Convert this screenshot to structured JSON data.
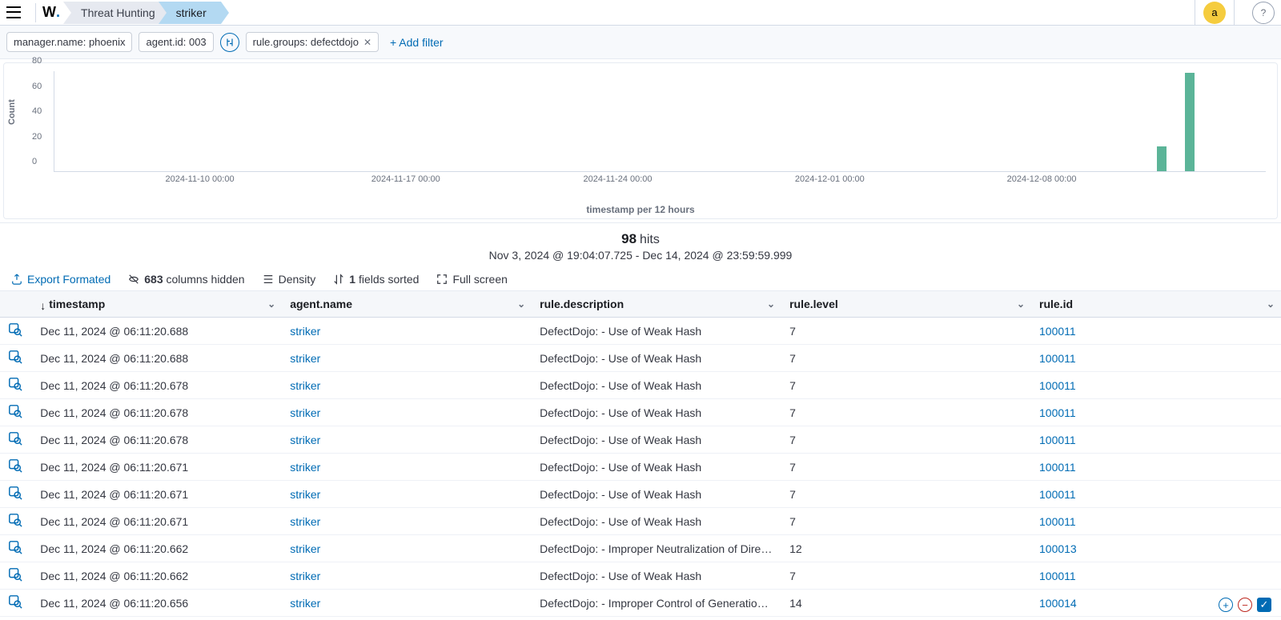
{
  "header": {
    "breadcrumbs": [
      "Threat Hunting",
      "striker"
    ],
    "avatar_letter": "a"
  },
  "filters": {
    "pills": [
      {
        "label": "manager.name: phoenix",
        "closable": false
      },
      {
        "label": "agent.id: 003",
        "closable": false
      },
      {
        "label": "rule.groups: defectdojo",
        "closable": true
      }
    ],
    "add_filter_label": "+ Add filter"
  },
  "chart_data": {
    "type": "bar",
    "ylabel": "Count",
    "xlabel": "timestamp per 12 hours",
    "y_ticks": [
      0,
      20,
      40,
      60,
      80
    ],
    "x_ticks": [
      "2024-11-10 00:00",
      "2024-11-17 00:00",
      "2024-11-24 00:00",
      "2024-12-01 00:00",
      "2024-12-08 00:00"
    ],
    "ylim": [
      0,
      80
    ],
    "bars": [
      {
        "pos_pct": 91.0,
        "value": 20
      },
      {
        "pos_pct": 93.3,
        "value": 78
      }
    ]
  },
  "hits": {
    "count": "98",
    "label": "hits",
    "range": "Nov 3, 2024 @ 19:04:07.725 - Dec 14, 2024 @ 23:59:59.999"
  },
  "toolbar": {
    "export_label": "Export Formated",
    "hidden_cols_count": "683",
    "hidden_cols_suffix": " columns hidden",
    "density_label": "Density",
    "sorted_count": "1",
    "sorted_suffix": " fields sorted",
    "fullscreen_label": "Full screen"
  },
  "table": {
    "columns": [
      "timestamp",
      "agent.name",
      "rule.description",
      "rule.level",
      "rule.id"
    ],
    "sort_col_index": 0,
    "rows": [
      {
        "timestamp": "Dec 11, 2024 @ 06:11:20.688",
        "agent": "striker",
        "desc": "DefectDojo: - Use of Weak Hash",
        "level": "7",
        "rule_id": "100011"
      },
      {
        "timestamp": "Dec 11, 2024 @ 06:11:20.688",
        "agent": "striker",
        "desc": "DefectDojo: - Use of Weak Hash",
        "level": "7",
        "rule_id": "100011"
      },
      {
        "timestamp": "Dec 11, 2024 @ 06:11:20.678",
        "agent": "striker",
        "desc": "DefectDojo: - Use of Weak Hash",
        "level": "7",
        "rule_id": "100011"
      },
      {
        "timestamp": "Dec 11, 2024 @ 06:11:20.678",
        "agent": "striker",
        "desc": "DefectDojo: - Use of Weak Hash",
        "level": "7",
        "rule_id": "100011"
      },
      {
        "timestamp": "Dec 11, 2024 @ 06:11:20.678",
        "agent": "striker",
        "desc": "DefectDojo: - Use of Weak Hash",
        "level": "7",
        "rule_id": "100011"
      },
      {
        "timestamp": "Dec 11, 2024 @ 06:11:20.671",
        "agent": "striker",
        "desc": "DefectDojo: - Use of Weak Hash",
        "level": "7",
        "rule_id": "100011"
      },
      {
        "timestamp": "Dec 11, 2024 @ 06:11:20.671",
        "agent": "striker",
        "desc": "DefectDojo: - Use of Weak Hash",
        "level": "7",
        "rule_id": "100011"
      },
      {
        "timestamp": "Dec 11, 2024 @ 06:11:20.671",
        "agent": "striker",
        "desc": "DefectDojo: - Use of Weak Hash",
        "level": "7",
        "rule_id": "100011"
      },
      {
        "timestamp": "Dec 11, 2024 @ 06:11:20.662",
        "agent": "striker",
        "desc": "DefectDojo: - Improper Neutralization of Direct...",
        "level": "12",
        "rule_id": "100013"
      },
      {
        "timestamp": "Dec 11, 2024 @ 06:11:20.662",
        "agent": "striker",
        "desc": "DefectDojo: - Use of Weak Hash",
        "level": "7",
        "rule_id": "100011"
      },
      {
        "timestamp": "Dec 11, 2024 @ 06:11:20.656",
        "agent": "striker",
        "desc": "DefectDojo: - Improper Control of Generation ...",
        "level": "14",
        "rule_id": "100014"
      }
    ]
  }
}
